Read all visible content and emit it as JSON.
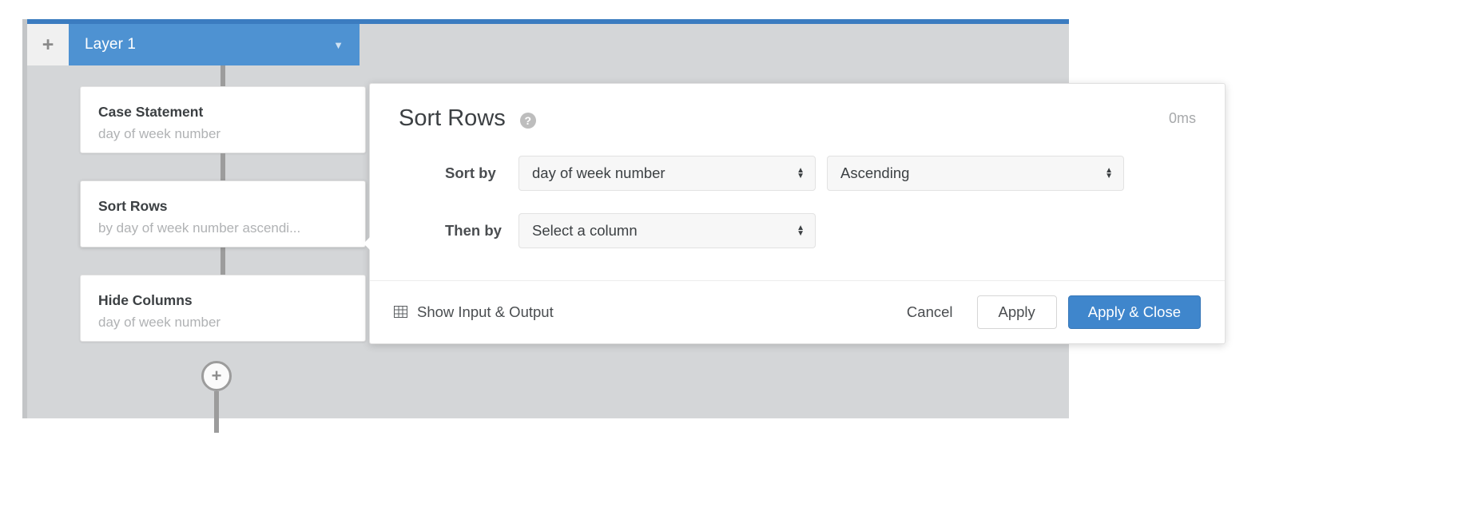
{
  "canvas": {
    "add_layer_label": "+",
    "layer_tab": {
      "label": "Layer 1",
      "caret": "▼"
    },
    "nodes": [
      {
        "title": "Case Statement",
        "subtitle": "day of week number"
      },
      {
        "title": "Sort Rows",
        "subtitle": "by day of week number ascendi..."
      },
      {
        "title": "Hide Columns",
        "subtitle": "day of week number"
      }
    ],
    "add_step_label": "+"
  },
  "panel": {
    "title": "Sort Rows",
    "help_icon_label": "?",
    "timing": "0ms",
    "rows": [
      {
        "label": "Sort by",
        "column_value": "day of week number",
        "order_value": "Ascending"
      },
      {
        "label": "Then by",
        "column_value": "Select a column"
      }
    ],
    "footer": {
      "show_io_label": "Show Input & Output",
      "cancel_label": "Cancel",
      "apply_label": "Apply",
      "apply_close_label": "Apply & Close"
    }
  },
  "colors": {
    "accent_blue": "#4e92d2",
    "primary_button": "#3f86cc",
    "canvas_gray": "#d4d6d8",
    "muted_text": "#b0b2b4"
  }
}
